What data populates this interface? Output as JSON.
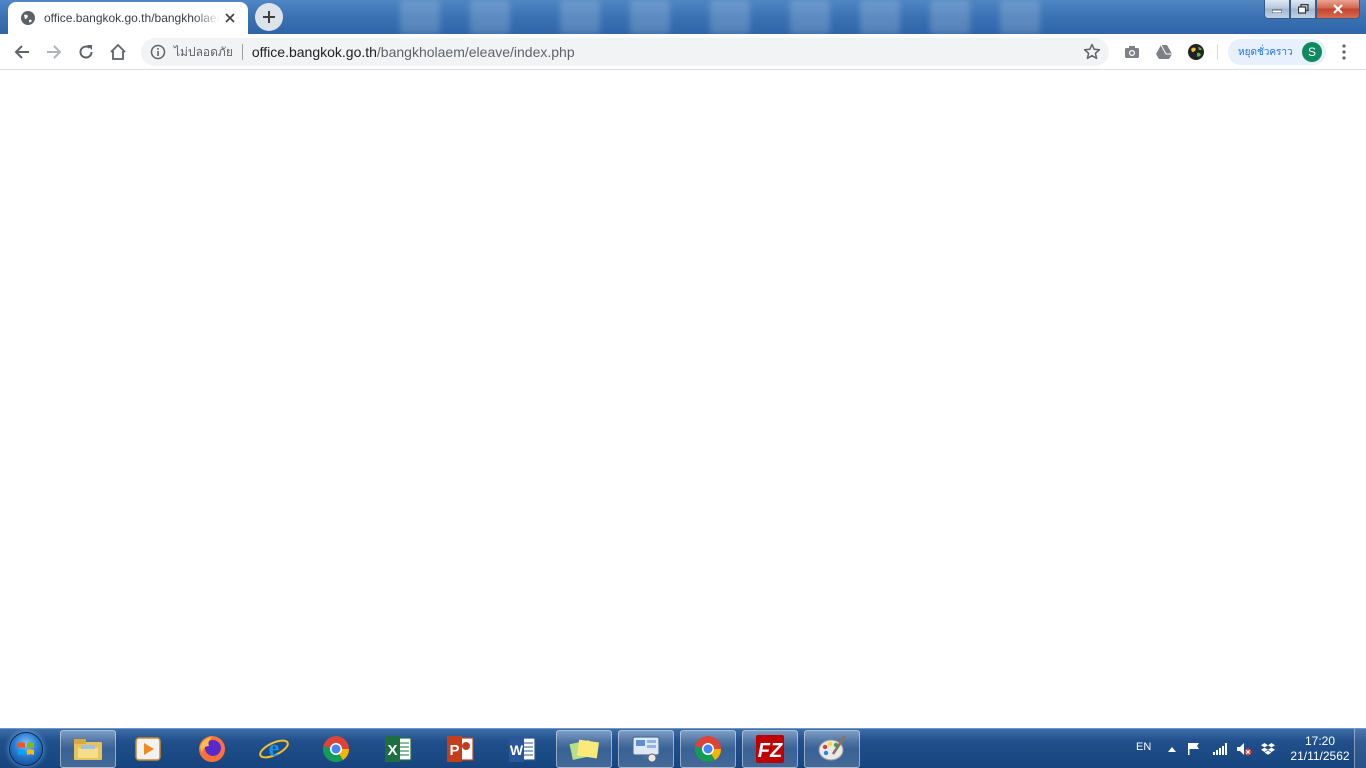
{
  "browser": {
    "tab": {
      "title": "office.bangkok.go.th/bangkholaem/eleave/index.php",
      "close_icon": "close-icon"
    },
    "new_tab_icon": "plus-icon",
    "window_controls": [
      "minimize-icon",
      "maximize-icon",
      "close-icon"
    ],
    "toolbar": {
      "back_icon": "arrow-left-icon",
      "forward_icon": "arrow-right-icon",
      "reload_icon": "reload-icon",
      "home_icon": "home-icon"
    },
    "omnibox": {
      "security_label": "ไม่ปลอดภัย",
      "url_host": "office.bangkok.go.th",
      "url_path": "/bangkholaem/eleave/index.php",
      "bookmark_icon": "star-icon"
    },
    "extensions": [
      "camera-icon",
      "drive-icon",
      "globe-extension-icon"
    ],
    "profile": {
      "label": "หยุดชั่วคราว",
      "avatar_letter": "S"
    },
    "menu_icon": "kebab-menu-icon"
  },
  "taskbar": {
    "apps": [
      "file-explorer-icon",
      "media-player-icon",
      "firefox-icon",
      "internet-explorer-icon",
      "chrome-icon",
      "excel-icon",
      "powerpoint-icon",
      "word-icon",
      "sticky-notes-icon",
      "remote-desktop-icon",
      "chrome-active-icon",
      "filezilla-icon",
      "paint-icon"
    ],
    "tray": {
      "language": "EN",
      "time": "17:20",
      "date": "21/11/2562"
    }
  },
  "colors": {
    "accent": "#1a73e8",
    "taskbar": "#16447e",
    "avatar": "#0f8a5f"
  }
}
